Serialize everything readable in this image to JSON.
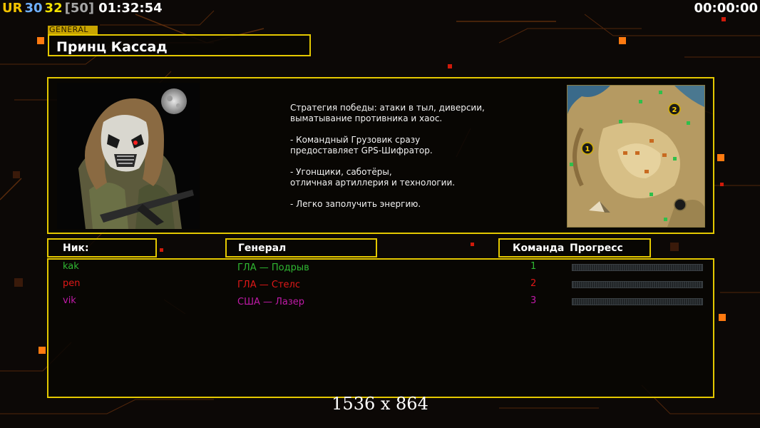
{
  "hud": {
    "tag": "UR",
    "fps_a": "30",
    "fps_b": "32",
    "fps_limit": "[50]",
    "time": "01:32:54",
    "timer": "00:00:00",
    "colors": {
      "tag": "#f2c200",
      "fps_a": "#6fb0ff",
      "fps_b": "#f2e200",
      "fps_limit": "#a6a6a6"
    }
  },
  "general": {
    "tag": "GENERAL",
    "name": "Принц Кассад",
    "description": [
      "Стратегия победы: атаки в тыл, диверсии,\n выматывание противника и хаос.",
      "- Командный Грузовик сразу\nпредоставляет GPS-Шифратор.",
      "- Угонщики, саботёры,\nотличная артиллерия и технологии.",
      "- Легко заполучить энергию."
    ]
  },
  "table": {
    "headers": {
      "nick": "Ник:",
      "general": "Генерал",
      "team": "Команда",
      "progress": "Прогресс"
    },
    "players": [
      {
        "nick": "kak",
        "general": "ГЛА — Подрыв",
        "team": "1",
        "color": "#2fb832",
        "progress": 0
      },
      {
        "nick": "pen",
        "general": "ГЛА — Стелс",
        "team": "2",
        "color": "#e01818",
        "progress": 0
      },
      {
        "nick": "vik",
        "general": "США — Лазер",
        "team": "3",
        "color": "#c01aa8",
        "progress": 0
      }
    ]
  },
  "minimap": {
    "start_markers": [
      "1",
      "2"
    ]
  },
  "overlay": {
    "resolution": "1536 x 864"
  },
  "colors": {
    "frame": "#e4c800",
    "accent_orange": "#ff7a10"
  }
}
